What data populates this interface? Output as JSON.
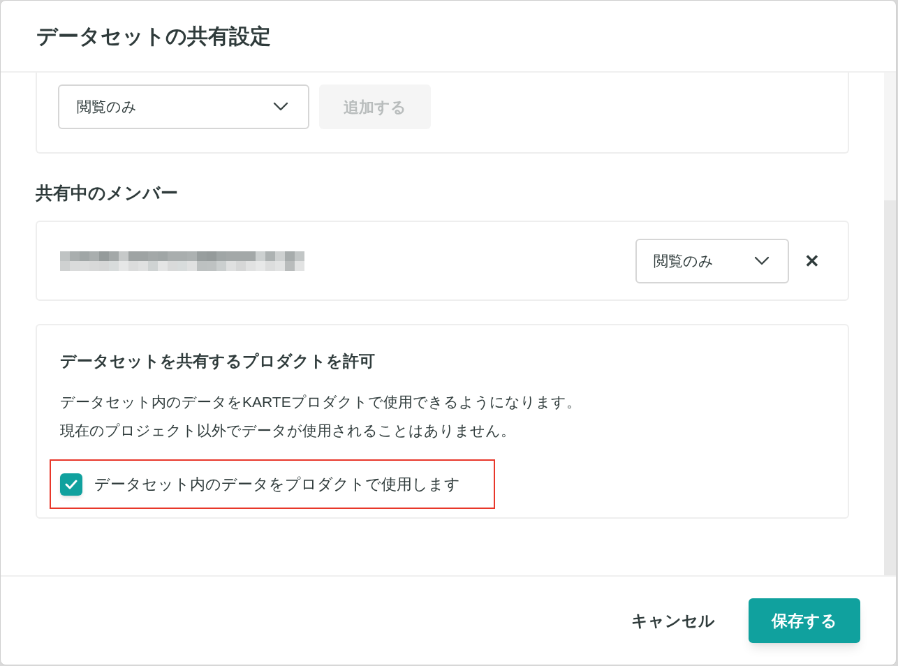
{
  "dialog": {
    "title": "データセットの共有設定"
  },
  "add_member": {
    "role_select": "閲覧のみ",
    "add_button": {
      "label": "追加する",
      "disabled": true
    }
  },
  "members_heading": "共有中のメンバー",
  "members": [
    {
      "name_redacted": true,
      "role": "閲覧のみ",
      "remove": "✕"
    }
  ],
  "product_permission": {
    "title": "データセットを共有するプロダクトを許可",
    "description": [
      "データセット内のデータをKARTEプロダクトで使用できるようになります。",
      "現在のプロジェクト以外でデータが使用されることはありません。"
    ],
    "checkbox": {
      "label": "データセット内のデータをプロダクトで使用します",
      "checked": true,
      "highlighted": true
    }
  },
  "footer": {
    "cancel": "キャンセル",
    "save": "保存する"
  }
}
